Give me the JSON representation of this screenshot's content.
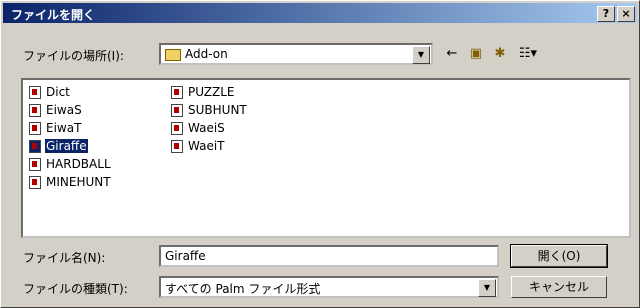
{
  "window": {
    "title": "ファイルを開く",
    "help_label": "?",
    "close_label": "×"
  },
  "location": {
    "label": "ファイルの場所(I):",
    "value": "Add-on"
  },
  "toolbar": {
    "back_icon": "←",
    "up_icon": "▣",
    "new_folder_icon": "✱",
    "view_icon": "☷▾"
  },
  "files": {
    "col1": [
      "Dict",
      "EiwaS",
      "EiwaT",
      "Giraffe",
      "HARDBALL",
      "MINEHUNT"
    ],
    "col2": [
      "PUZZLE",
      "SUBHUNT",
      "WaeiS",
      "WaeiT"
    ],
    "selected": "Giraffe"
  },
  "filename": {
    "label": "ファイル名(N):",
    "value": "Giraffe"
  },
  "filetype": {
    "label": "ファイルの種類(T):",
    "value": "すべての Palm ファイル形式"
  },
  "buttons": {
    "open": "開く(O)",
    "cancel": "キャンセル"
  }
}
